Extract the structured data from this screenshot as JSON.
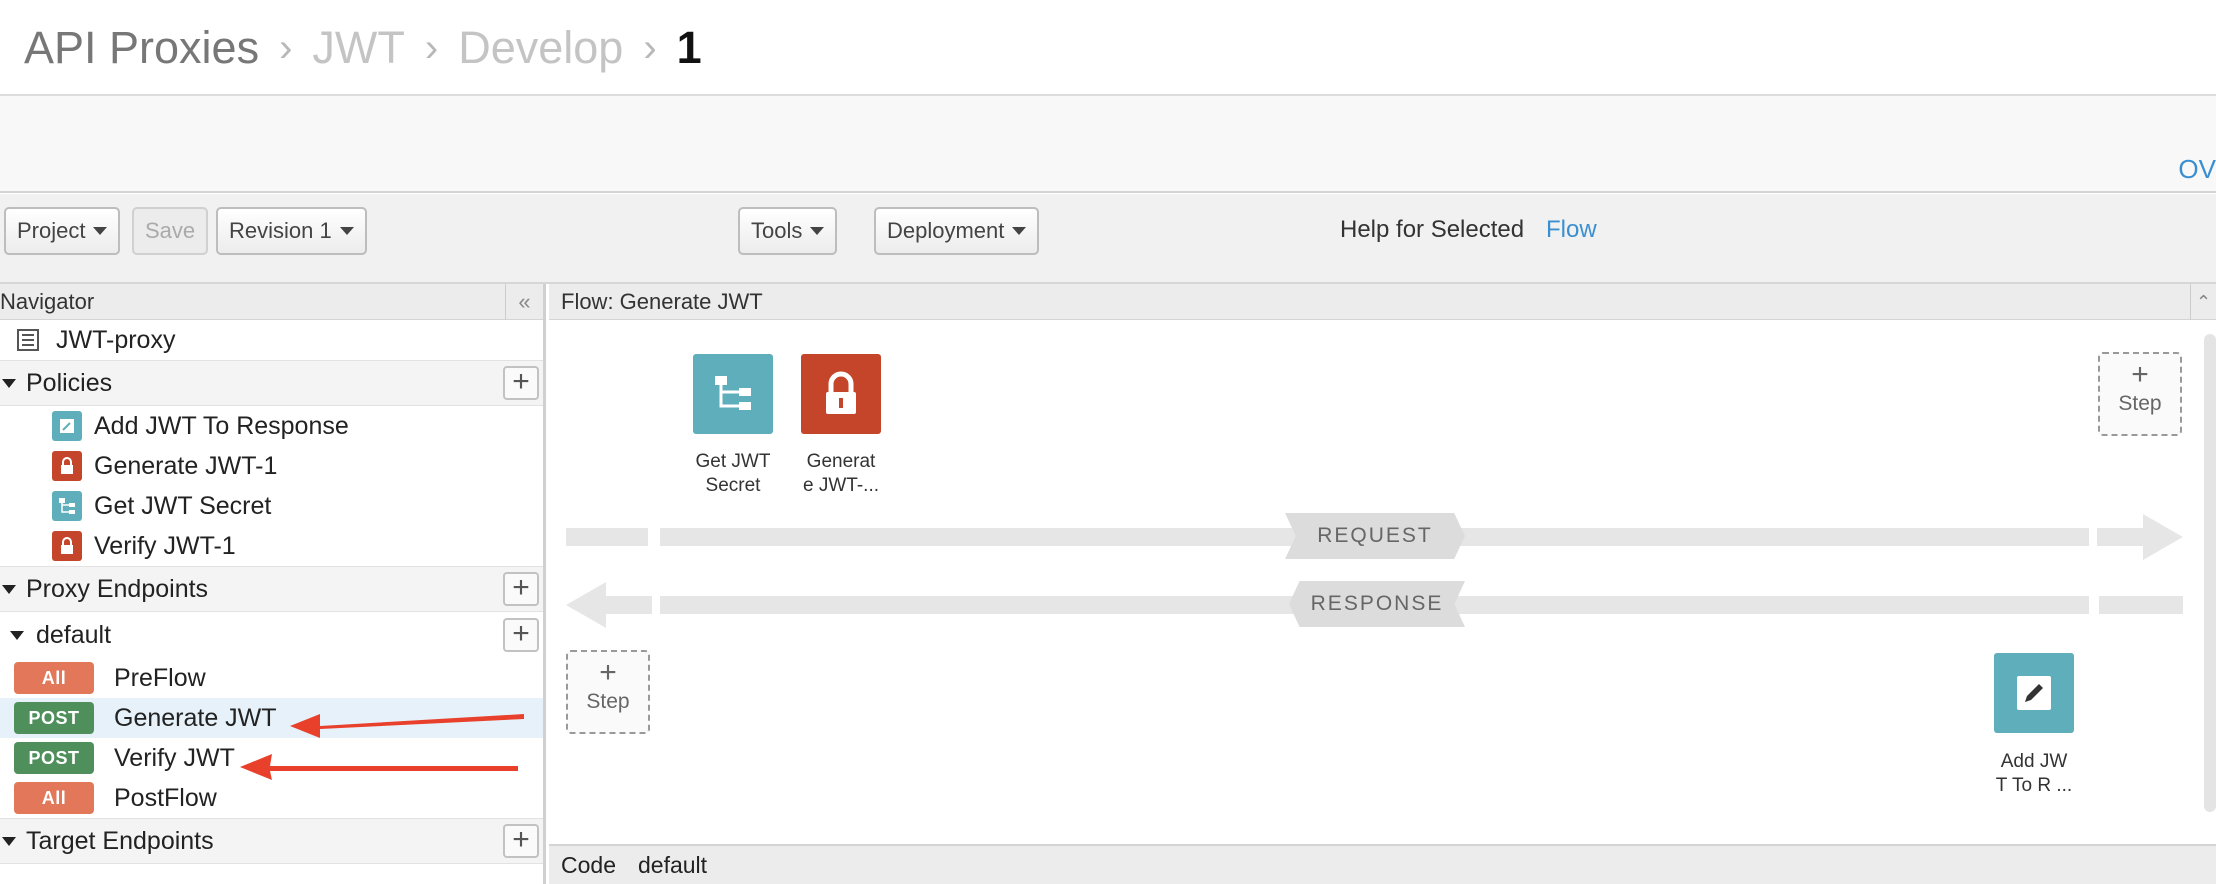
{
  "breadcrumb": {
    "items": [
      "API Proxies",
      "JWT",
      "Develop",
      "1"
    ],
    "separator": "›"
  },
  "header": {
    "overflow_link": "OV"
  },
  "toolbar": {
    "project": "Project",
    "save": "Save",
    "revision": "Revision 1",
    "tools": "Tools",
    "deployment": "Deployment",
    "help_text": "Help for Selected",
    "help_link": "Flow"
  },
  "navigator": {
    "title": "Navigator",
    "collapse": "«",
    "proxy_name": "JWT-proxy",
    "policies_label": "Policies",
    "policies": [
      {
        "name": "Add JWT To Response",
        "icon": "edit-icon"
      },
      {
        "name": "Generate JWT-1",
        "icon": "lock-icon"
      },
      {
        "name": "Get JWT Secret",
        "icon": "tree-icon"
      },
      {
        "name": "Verify JWT-1",
        "icon": "lock-icon"
      }
    ],
    "proxy_endpoints_label": "Proxy Endpoints",
    "endpoint_name": "default",
    "flows": [
      {
        "method": "All",
        "name": "PreFlow"
      },
      {
        "method": "POST",
        "name": "Generate JWT"
      },
      {
        "method": "POST",
        "name": "Verify JWT"
      },
      {
        "method": "All",
        "name": "PostFlow"
      }
    ],
    "target_endpoints_label": "Target Endpoints"
  },
  "flow_panel": {
    "title": "Flow: Generate JWT",
    "request_steps": [
      {
        "label_line1": "Get JWT",
        "label_line2": "Secret",
        "icon": "tree-icon",
        "color": "#5faebb"
      },
      {
        "label_line1": "Generat",
        "label_line2": "e JWT-...",
        "icon": "lock-icon",
        "color": "#c4452a"
      }
    ],
    "response_steps": [
      {
        "label_line1": "Add JW",
        "label_line2": "T To R ...",
        "icon": "edit-icon",
        "color": "#5faebb"
      }
    ],
    "add_step_plus": "+",
    "add_step_label": "Step",
    "request_label": "REQUEST",
    "response_label": "RESPONSE"
  },
  "code_bar": {
    "label": "Code",
    "value": "default"
  },
  "colors": {
    "accent": "#3b8fd0",
    "annotation_arrow": "#e8402a",
    "badge_all": "#e2775a",
    "badge_post": "#4e8f5b"
  }
}
